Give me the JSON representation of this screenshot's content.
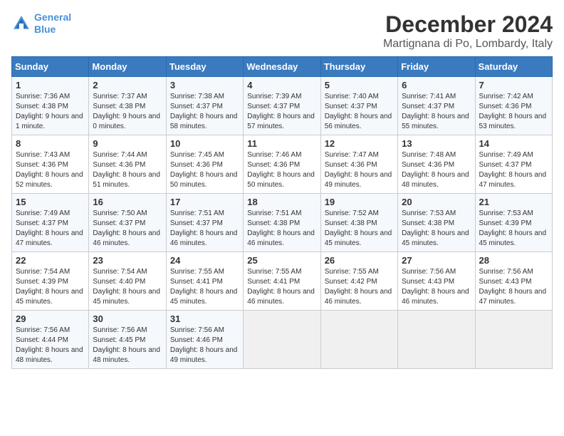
{
  "header": {
    "logo_line1": "General",
    "logo_line2": "Blue",
    "month_title": "December 2024",
    "location": "Martignana di Po, Lombardy, Italy"
  },
  "columns": [
    "Sunday",
    "Monday",
    "Tuesday",
    "Wednesday",
    "Thursday",
    "Friday",
    "Saturday"
  ],
  "weeks": [
    [
      {
        "day": "1",
        "sunrise": "Sunrise: 7:36 AM",
        "sunset": "Sunset: 4:38 PM",
        "daylight": "Daylight: 9 hours and 1 minute."
      },
      {
        "day": "2",
        "sunrise": "Sunrise: 7:37 AM",
        "sunset": "Sunset: 4:38 PM",
        "daylight": "Daylight: 9 hours and 0 minutes."
      },
      {
        "day": "3",
        "sunrise": "Sunrise: 7:38 AM",
        "sunset": "Sunset: 4:37 PM",
        "daylight": "Daylight: 8 hours and 58 minutes."
      },
      {
        "day": "4",
        "sunrise": "Sunrise: 7:39 AM",
        "sunset": "Sunset: 4:37 PM",
        "daylight": "Daylight: 8 hours and 57 minutes."
      },
      {
        "day": "5",
        "sunrise": "Sunrise: 7:40 AM",
        "sunset": "Sunset: 4:37 PM",
        "daylight": "Daylight: 8 hours and 56 minutes."
      },
      {
        "day": "6",
        "sunrise": "Sunrise: 7:41 AM",
        "sunset": "Sunset: 4:37 PM",
        "daylight": "Daylight: 8 hours and 55 minutes."
      },
      {
        "day": "7",
        "sunrise": "Sunrise: 7:42 AM",
        "sunset": "Sunset: 4:36 PM",
        "daylight": "Daylight: 8 hours and 53 minutes."
      }
    ],
    [
      {
        "day": "8",
        "sunrise": "Sunrise: 7:43 AM",
        "sunset": "Sunset: 4:36 PM",
        "daylight": "Daylight: 8 hours and 52 minutes."
      },
      {
        "day": "9",
        "sunrise": "Sunrise: 7:44 AM",
        "sunset": "Sunset: 4:36 PM",
        "daylight": "Daylight: 8 hours and 51 minutes."
      },
      {
        "day": "10",
        "sunrise": "Sunrise: 7:45 AM",
        "sunset": "Sunset: 4:36 PM",
        "daylight": "Daylight: 8 hours and 50 minutes."
      },
      {
        "day": "11",
        "sunrise": "Sunrise: 7:46 AM",
        "sunset": "Sunset: 4:36 PM",
        "daylight": "Daylight: 8 hours and 50 minutes."
      },
      {
        "day": "12",
        "sunrise": "Sunrise: 7:47 AM",
        "sunset": "Sunset: 4:36 PM",
        "daylight": "Daylight: 8 hours and 49 minutes."
      },
      {
        "day": "13",
        "sunrise": "Sunrise: 7:48 AM",
        "sunset": "Sunset: 4:36 PM",
        "daylight": "Daylight: 8 hours and 48 minutes."
      },
      {
        "day": "14",
        "sunrise": "Sunrise: 7:49 AM",
        "sunset": "Sunset: 4:37 PM",
        "daylight": "Daylight: 8 hours and 47 minutes."
      }
    ],
    [
      {
        "day": "15",
        "sunrise": "Sunrise: 7:49 AM",
        "sunset": "Sunset: 4:37 PM",
        "daylight": "Daylight: 8 hours and 47 minutes."
      },
      {
        "day": "16",
        "sunrise": "Sunrise: 7:50 AM",
        "sunset": "Sunset: 4:37 PM",
        "daylight": "Daylight: 8 hours and 46 minutes."
      },
      {
        "day": "17",
        "sunrise": "Sunrise: 7:51 AM",
        "sunset": "Sunset: 4:37 PM",
        "daylight": "Daylight: 8 hours and 46 minutes."
      },
      {
        "day": "18",
        "sunrise": "Sunrise: 7:51 AM",
        "sunset": "Sunset: 4:38 PM",
        "daylight": "Daylight: 8 hours and 46 minutes."
      },
      {
        "day": "19",
        "sunrise": "Sunrise: 7:52 AM",
        "sunset": "Sunset: 4:38 PM",
        "daylight": "Daylight: 8 hours and 45 minutes."
      },
      {
        "day": "20",
        "sunrise": "Sunrise: 7:53 AM",
        "sunset": "Sunset: 4:38 PM",
        "daylight": "Daylight: 8 hours and 45 minutes."
      },
      {
        "day": "21",
        "sunrise": "Sunrise: 7:53 AM",
        "sunset": "Sunset: 4:39 PM",
        "daylight": "Daylight: 8 hours and 45 minutes."
      }
    ],
    [
      {
        "day": "22",
        "sunrise": "Sunrise: 7:54 AM",
        "sunset": "Sunset: 4:39 PM",
        "daylight": "Daylight: 8 hours and 45 minutes."
      },
      {
        "day": "23",
        "sunrise": "Sunrise: 7:54 AM",
        "sunset": "Sunset: 4:40 PM",
        "daylight": "Daylight: 8 hours and 45 minutes."
      },
      {
        "day": "24",
        "sunrise": "Sunrise: 7:55 AM",
        "sunset": "Sunset: 4:41 PM",
        "daylight": "Daylight: 8 hours and 45 minutes."
      },
      {
        "day": "25",
        "sunrise": "Sunrise: 7:55 AM",
        "sunset": "Sunset: 4:41 PM",
        "daylight": "Daylight: 8 hours and 46 minutes."
      },
      {
        "day": "26",
        "sunrise": "Sunrise: 7:55 AM",
        "sunset": "Sunset: 4:42 PM",
        "daylight": "Daylight: 8 hours and 46 minutes."
      },
      {
        "day": "27",
        "sunrise": "Sunrise: 7:56 AM",
        "sunset": "Sunset: 4:43 PM",
        "daylight": "Daylight: 8 hours and 46 minutes."
      },
      {
        "day": "28",
        "sunrise": "Sunrise: 7:56 AM",
        "sunset": "Sunset: 4:43 PM",
        "daylight": "Daylight: 8 hours and 47 minutes."
      }
    ],
    [
      {
        "day": "29",
        "sunrise": "Sunrise: 7:56 AM",
        "sunset": "Sunset: 4:44 PM",
        "daylight": "Daylight: 8 hours and 48 minutes."
      },
      {
        "day": "30",
        "sunrise": "Sunrise: 7:56 AM",
        "sunset": "Sunset: 4:45 PM",
        "daylight": "Daylight: 8 hours and 48 minutes."
      },
      {
        "day": "31",
        "sunrise": "Sunrise: 7:56 AM",
        "sunset": "Sunset: 4:46 PM",
        "daylight": "Daylight: 8 hours and 49 minutes."
      },
      null,
      null,
      null,
      null
    ]
  ]
}
